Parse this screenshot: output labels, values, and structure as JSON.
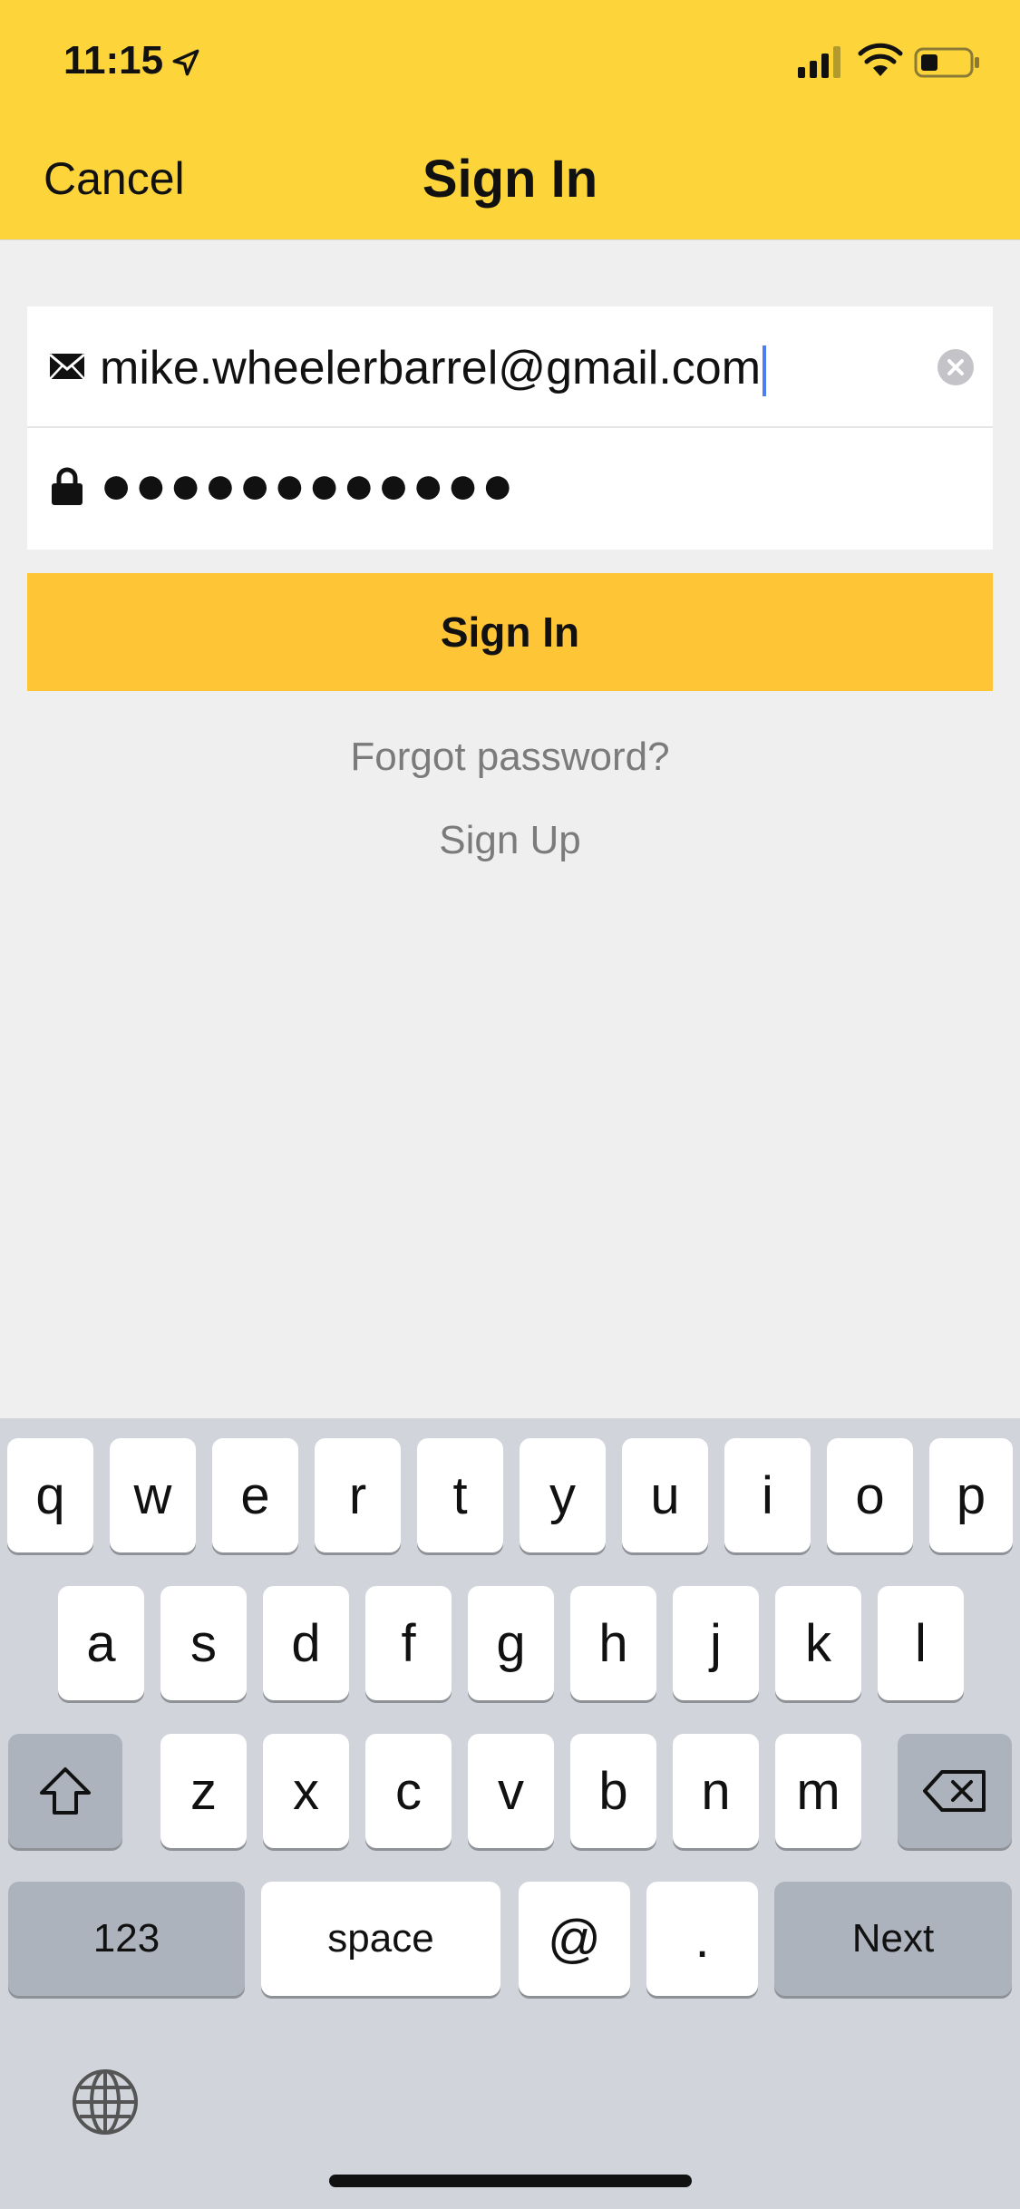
{
  "status_bar": {
    "time": "11:15"
  },
  "nav": {
    "cancel_label": "Cancel",
    "title": "Sign In"
  },
  "form": {
    "email_value": "mike.wheelerbarrel@gmail.com",
    "password_value": "●●●●●●●●●●●●",
    "signin_label": "Sign In",
    "forgot_label": "Forgot password?",
    "signup_label": "Sign Up"
  },
  "keyboard": {
    "row1": [
      "q",
      "w",
      "e",
      "r",
      "t",
      "y",
      "u",
      "i",
      "o",
      "p"
    ],
    "row2": [
      "a",
      "s",
      "d",
      "f",
      "g",
      "h",
      "j",
      "k",
      "l"
    ],
    "row3": [
      "z",
      "x",
      "c",
      "v",
      "b",
      "n",
      "m"
    ],
    "numbers_label": "123",
    "space_label": "space",
    "at_label": "@",
    "dot_label": ".",
    "next_label": "Next"
  },
  "colors": {
    "header": "#fdd53a",
    "signin_button": "#fec537",
    "caret": "#4f7bf7",
    "keyboard_bg": "#d1d5db"
  },
  "icons": [
    "location-arrow-icon",
    "signal-icon",
    "wifi-icon",
    "battery-icon",
    "mail-icon",
    "lock-icon",
    "clear-icon",
    "shift-icon",
    "backspace-icon",
    "globe-icon"
  ]
}
